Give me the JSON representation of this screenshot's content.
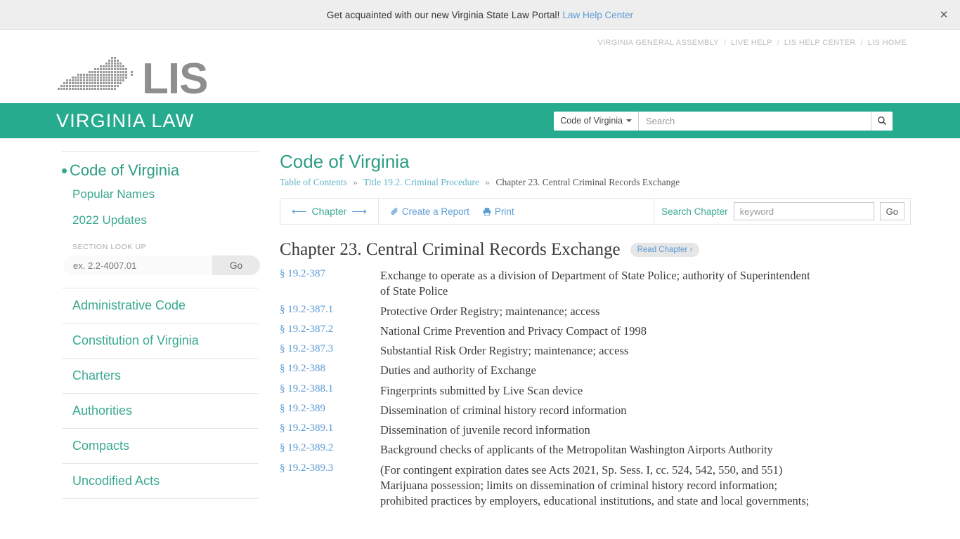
{
  "promo": {
    "text": "Get acquainted with our new Virginia State Law Portal!",
    "link_label": "Law Help Center",
    "close_label": "×"
  },
  "utility_nav": {
    "separator": "/",
    "items": [
      {
        "label": "VIRGINIA GENERAL ASSEMBLY"
      },
      {
        "label": "LIVE HELP"
      },
      {
        "label": "LIS HELP CENTER"
      },
      {
        "label": "LIS HOME"
      }
    ]
  },
  "brand": {
    "logo_text": "LIS",
    "logo_map_icon": "virginia-map-dots-icon",
    "site_title": "VIRGINIA LAW",
    "green": "#27ab8e"
  },
  "header_search": {
    "scope_label": "Code of Virginia",
    "caret_icon": "chevron-down-icon",
    "placeholder": "Search",
    "value": "",
    "button_icon": "search-icon"
  },
  "sidebar": {
    "primary": {
      "label": "Code of Virginia",
      "bullet": true
    },
    "sub_items": [
      {
        "label": "Popular Names"
      },
      {
        "label": "2022 Updates"
      }
    ],
    "lookup": {
      "label": "SECTION LOOK UP",
      "placeholder": "ex. 2.2-4007.01",
      "value": "",
      "go_label": "Go"
    },
    "sections": [
      {
        "label": "Administrative Code"
      },
      {
        "label": "Constitution of Virginia"
      },
      {
        "label": "Charters"
      },
      {
        "label": "Authorities"
      },
      {
        "label": "Compacts"
      },
      {
        "label": "Uncodified Acts"
      }
    ]
  },
  "main": {
    "title": "Code of Virginia",
    "breadcrumb": {
      "items": [
        {
          "label": "Table of Contents",
          "current": false
        },
        {
          "label": "Title 19.2. Criminal Procedure",
          "current": false
        },
        {
          "label": "Chapter 23. Central Criminal Records Exchange",
          "current": true
        }
      ],
      "separator": "»"
    },
    "toolbar": {
      "chapter_nav": {
        "prev_icon": "arrow-left-icon",
        "label": "Chapter",
        "next_icon": "arrow-right-icon"
      },
      "create_report": {
        "label": "Create a Report",
        "icon": "paperclip-icon"
      },
      "print": {
        "label": "Print",
        "icon": "printer-icon"
      },
      "search_chapter": {
        "label": "Search Chapter",
        "placeholder": "keyword",
        "value": "",
        "go_label": "Go"
      }
    },
    "chapter_title": "Chapter 23. Central Criminal Records Exchange",
    "read_chapter_badge": "Read Chapter ›",
    "sections": [
      {
        "number": "§ 19.2-387",
        "lines": [
          "Exchange to operate as a division of Department of State Police; authority of Superintendent",
          "of State Police"
        ]
      },
      {
        "number": "§ 19.2-387.1",
        "lines": [
          "Protective Order Registry; maintenance; access"
        ]
      },
      {
        "number": "§ 19.2-387.2",
        "lines": [
          "National Crime Prevention and Privacy Compact of 1998"
        ]
      },
      {
        "number": "§ 19.2-387.3",
        "lines": [
          "Substantial Risk Order Registry; maintenance; access"
        ]
      },
      {
        "number": "§ 19.2-388",
        "lines": [
          "Duties and authority of Exchange"
        ]
      },
      {
        "number": "§ 19.2-388.1",
        "lines": [
          "Fingerprints submitted by Live Scan device"
        ]
      },
      {
        "number": "§ 19.2-389",
        "lines": [
          "Dissemination of criminal history record information"
        ]
      },
      {
        "number": "§ 19.2-389.1",
        "lines": [
          "Dissemination of juvenile record information"
        ]
      },
      {
        "number": "§ 19.2-389.2",
        "lines": [
          "Background checks of applicants of the Metropolitan Washington Airports Authority"
        ]
      },
      {
        "number": "§ 19.2-389.3",
        "lines": [
          "(For contingent expiration dates see Acts 2021, Sp. Sess. I, cc. 524, 542, 550, and 551)",
          "Marijuana possession; limits on dissemination of criminal history record information;",
          "prohibited practices by employers, educational institutions, and state and local governments;"
        ]
      }
    ]
  }
}
